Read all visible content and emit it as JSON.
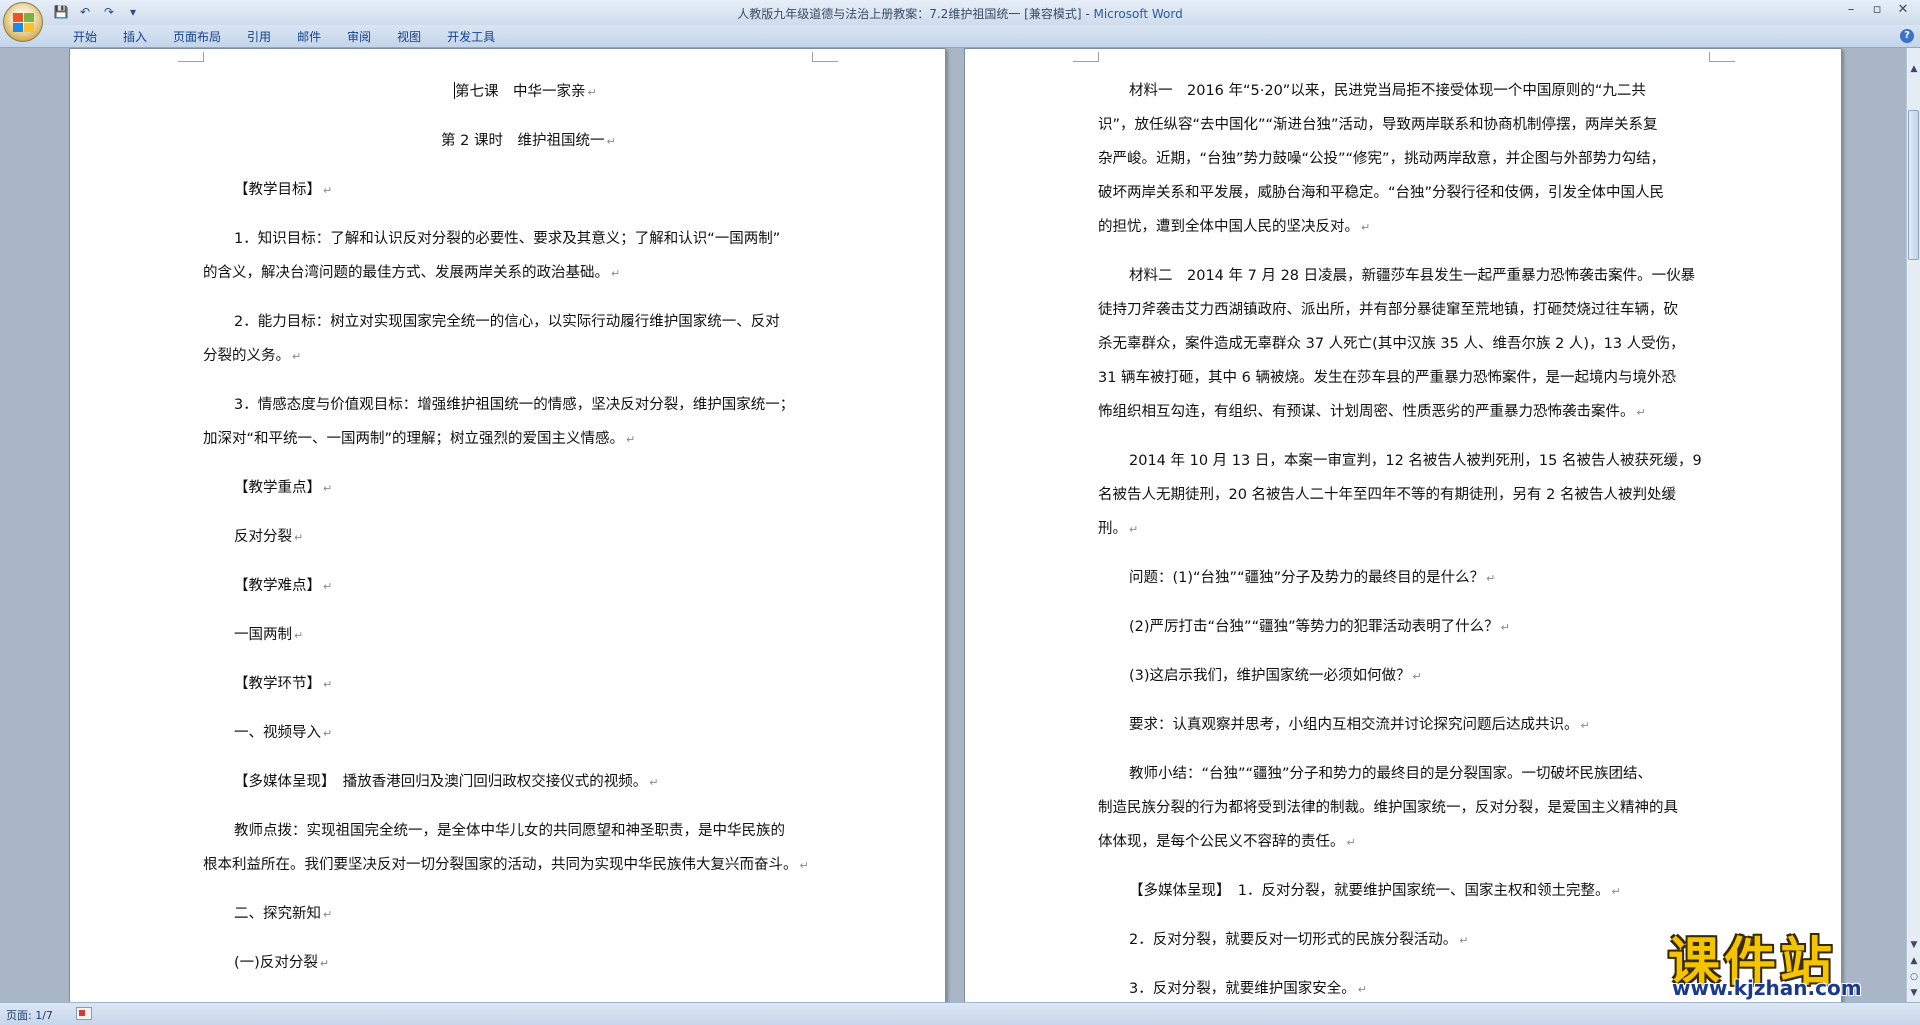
{
  "window": {
    "title": "人教版九年级道德与法治上册教案：7.2维护祖国统一 [兼容模式]",
    "app_name": "Microsoft Word",
    "separator": " - ",
    "controls": [
      "–",
      "▫",
      "✕"
    ]
  },
  "qat": {
    "save": "💾",
    "undo": "↶",
    "redo": "↷",
    "more": "▾"
  },
  "ribbon": {
    "tabs": [
      "开始",
      "插入",
      "页面布局",
      "引用",
      "邮件",
      "审阅",
      "视图",
      "开发工具"
    ],
    "help": "?"
  },
  "doc": {
    "pilcrow": "↵",
    "left_page": [
      "第七课　中华一家亲",
      "第 2 课时　维护祖国统一",
      "【教学目标】",
      "1．知识目标：了解和认识反对分裂的必要性、要求及其意义；了解和认识“一国两制”",
      "的含义，解决台湾问题的最佳方式、发展两岸关系的政治基础。",
      "2．能力目标：树立对实现国家完全统一的信心，以实际行动履行维护国家统一、反对",
      "分裂的义务。",
      "3．情感态度与价值观目标：增强维护祖国统一的情感，坚决反对分裂，维护国家统一；",
      "加深对“和平统一、一国两制”的理解；树立强烈的爱国主义情感。",
      "【教学重点】",
      "反对分裂",
      "【教学难点】",
      "一国两制",
      "【教学环节】",
      "一、视频导入",
      "【多媒体呈现】　播放香港回归及澳门回归政权交接仪式的视频。",
      "教师点拨：实现祖国完全统一，是全体中华儿女的共同愿望和神圣职责，是中华民族的",
      "根本利益所在。我们要坚决反对一切分裂国家的活动，共同为实现中华民族伟大复兴而奋斗。",
      "二、探究新知",
      "(一)反对分裂"
    ],
    "right_page": [
      "材料一　2016 年“5·20”以来，民进党当局拒不接受体现一个中国原则的“九二共",
      "识”，放任纵容“去中国化”“渐进台独”活动，导致两岸联系和协商机制停摆，两岸关系复",
      "杂严峻。近期，“台独”势力鼓噪“公投”“修宪”，挑动两岸敌意，并企图与外部势力勾结，",
      "破坏两岸关系和平发展，威胁台海和平稳定。“台独”分裂行径和伎俩，引发全体中国人民",
      "的担忧，遭到全体中国人民的坚决反对。",
      "材料二　2014 年 7 月 28 日凌晨，新疆莎车县发生一起严重暴力恐怖袭击案件。一伙暴",
      "徒持刀斧袭击艾力西湖镇政府、派出所，并有部分暴徒窜至荒地镇，打砸焚烧过往车辆，砍",
      "杀无辜群众，案件造成无辜群众 37 人死亡(其中汉族 35 人、维吾尔族 2 人)，13 人受伤，",
      "31 辆车被打砸，其中 6 辆被烧。发生在莎车县的严重暴力恐怖案件，是一起境内与境外恐",
      "怖组织相互勾连，有组织、有预谋、计划周密、性质恶劣的严重暴力恐怖袭击案件。",
      "2014 年 10 月 13 日，本案一审宣判，12 名被告人被判死刑，15 名被告人被获死缓，9",
      "名被告人无期徒刑，20 名被告人二十年至四年不等的有期徒刑，另有 2 名被告人被判处缓",
      "刑。",
      "问题：(1)“台独”“疆独”分子及势力的最终目的是什么？",
      "(2)严厉打击“台独”“疆独”等势力的犯罪活动表明了什么？",
      "(3)这启示我们，维护国家统一必须如何做？",
      "要求：认真观察并思考，小组内互相交流并讨论探究问题后达成共识。",
      "教师小结：“台独”“疆独”分子和势力的最终目的是分裂国家。一切破坏民族团结、",
      "制造民族分裂的行为都将受到法律的制裁。维护国家统一，反对分裂，是爱国主义精神的具",
      "体体现，是每个公民义不容辞的责任。",
      "【多媒体呈现】　1．反对分裂，就要维护国家统一、国家主权和领土完整。",
      "2．反对分裂，就要反对一切形式的民族分裂活动。",
      "3．反对分裂，就要维护国家安全。"
    ]
  },
  "statusbar": {
    "page": "页面: 1/7"
  },
  "watermark": {
    "title": "课件站",
    "url": "www.kjzhan.com"
  },
  "scroll": {
    "up": "▲",
    "down": "▼",
    "prev": "▲",
    "browse": "○",
    "next": "▼"
  }
}
